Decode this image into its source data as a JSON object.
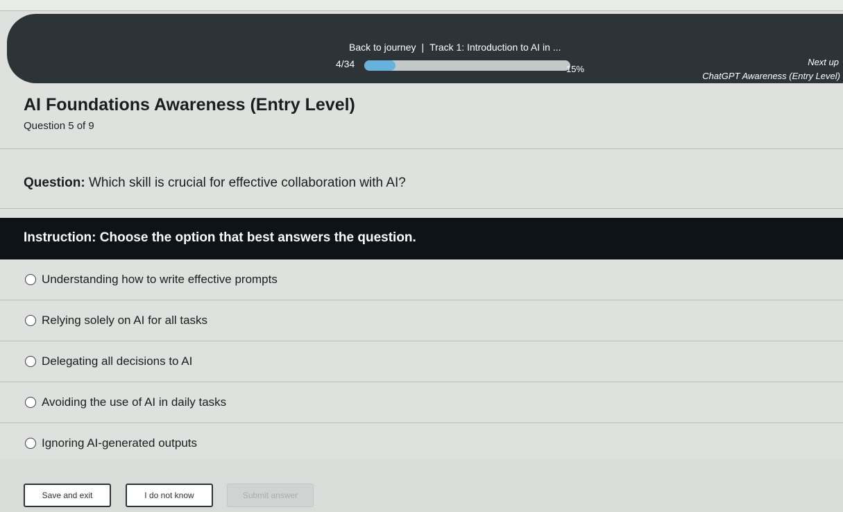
{
  "header": {
    "back_label": "Back to journey",
    "separator": "|",
    "track_title": "Track 1: Introduction to AI in ...",
    "step_counter": "4/34",
    "progress_percent_label": "15%",
    "progress_fraction": 0.15,
    "next_up_label": "Next up",
    "next_up_title": "ChatGPT Awareness (Entry Level)"
  },
  "quiz": {
    "title": "AI Foundations Awareness (Entry Level)",
    "question_counter": "Question 5 of 9",
    "question_prefix": "Question:",
    "question_text": "Which skill is crucial for effective collaboration with AI?",
    "instruction": "Instruction: Choose the option that best answers the question.",
    "options": [
      "Understanding how to write effective prompts",
      "Relying solely on AI for all tasks",
      "Delegating all decisions to AI",
      "Avoiding the use of AI in daily tasks",
      "Ignoring AI-generated outputs"
    ]
  },
  "footer": {
    "save_exit_label": "Save and exit",
    "dont_know_label": "I do not know",
    "submit_label": "Submit answer"
  },
  "colors": {
    "header_bg": "#2c3438",
    "instruction_bg": "#0d1316",
    "progress_fill": "#66b2dd"
  }
}
